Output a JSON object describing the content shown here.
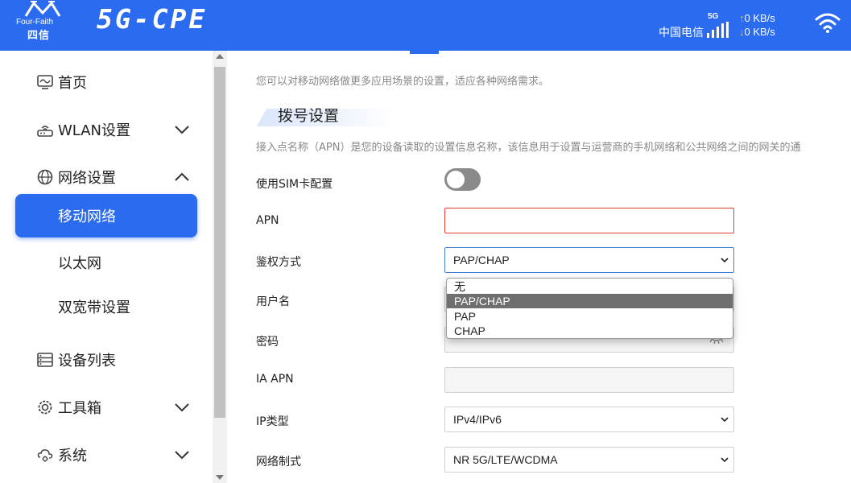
{
  "header": {
    "logo_text": "Four-Faith",
    "logo_cn": "四信",
    "brand": "5G-CPE",
    "carrier": "中国电信",
    "network_gen": "5G",
    "upload_speed": "0 KB/s",
    "download_speed": "0 KB/s",
    "upload_arrow": "↑",
    "download_arrow": "↓",
    "accent_color": "#2b6bf0"
  },
  "sidebar": {
    "items": [
      {
        "label": "首页",
        "icon": "monitor-icon"
      },
      {
        "label": "WLAN设置",
        "icon": "router-icon",
        "expanded": false
      },
      {
        "label": "网络设置",
        "icon": "globe-icon",
        "expanded": true
      },
      {
        "label": "设备列表",
        "icon": "list-icon"
      },
      {
        "label": "工具箱",
        "icon": "gear-icon",
        "expanded": false
      },
      {
        "label": "系统",
        "icon": "cloud-gear-icon",
        "expanded": false
      }
    ],
    "sub_items": [
      {
        "label": "移动网络",
        "active": true
      },
      {
        "label": "以太网",
        "active": false
      },
      {
        "label": "双宽带设置",
        "active": false
      }
    ]
  },
  "main": {
    "description": "您可以对移动网络做更多应用场景的设置，适应各种网络需求。",
    "section_title": "拨号设置",
    "apn_description": "接入点名称（APN）是您的设备读取的设置信息名称，该信息用于设置与运营商的手机网络和公共网络之间的网关的通",
    "form": {
      "use_sim_label": "使用SIM卡配置",
      "use_sim_value": false,
      "apn_label": "APN",
      "apn_value": "",
      "auth_label": "鉴权方式",
      "auth_value": "PAP/CHAP",
      "auth_options": [
        "无",
        "PAP/CHAP",
        "PAP",
        "CHAP"
      ],
      "username_label": "用户名",
      "password_label": "密码",
      "ia_apn_label": "IA APN",
      "ia_apn_value": "",
      "ip_type_label": "IP类型",
      "ip_type_value": "IPv4/IPv6",
      "network_mode_label": "网络制式",
      "network_mode_value": "NR 5G/LTE/WCDMA"
    }
  }
}
